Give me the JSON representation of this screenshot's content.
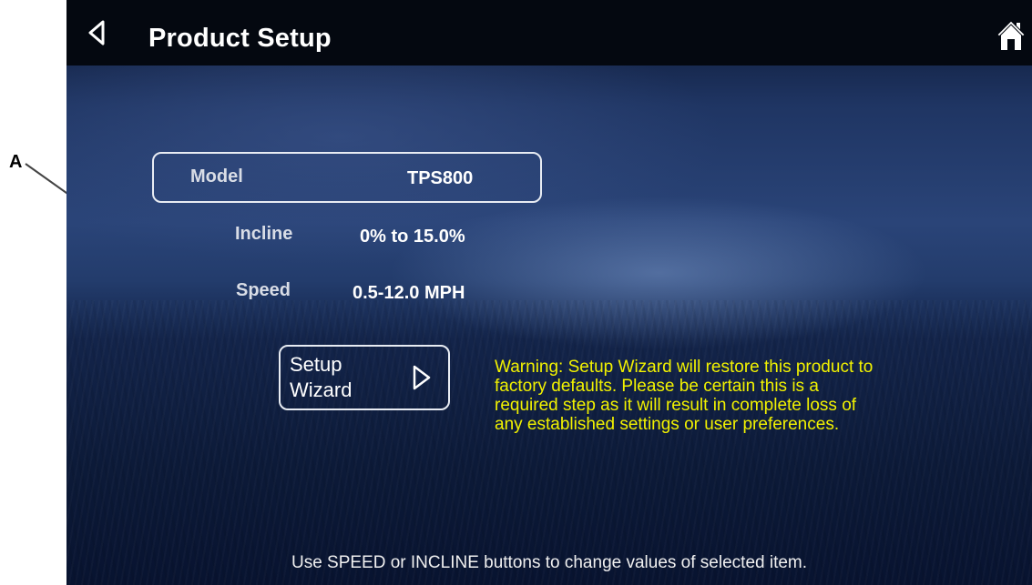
{
  "callout": {
    "label": "A"
  },
  "header": {
    "title": "Product Setup",
    "back_icon": "chevron-left-icon",
    "home_icon": "home-icon"
  },
  "model": {
    "label": "Model",
    "value": "TPS800"
  },
  "incline": {
    "label": "Incline",
    "value": "0% to 15.0%"
  },
  "speed": {
    "label": "Speed",
    "value": "0.5-12.0 MPH"
  },
  "setup_wizard": {
    "label": "Setup\nWizard",
    "arrow_icon": "play-arrow-icon"
  },
  "warning": {
    "text": "Warning: Setup Wizard will restore this product to factory defaults. Please be certain this is a required step as it will result in complete loss of any established settings or user preferences."
  },
  "hint": {
    "text": "Use SPEED or INCLINE buttons to change values of selected item."
  },
  "colors": {
    "header_bg": "#040810",
    "warning_text": "#f2f200",
    "border": "#e8ecf3"
  }
}
